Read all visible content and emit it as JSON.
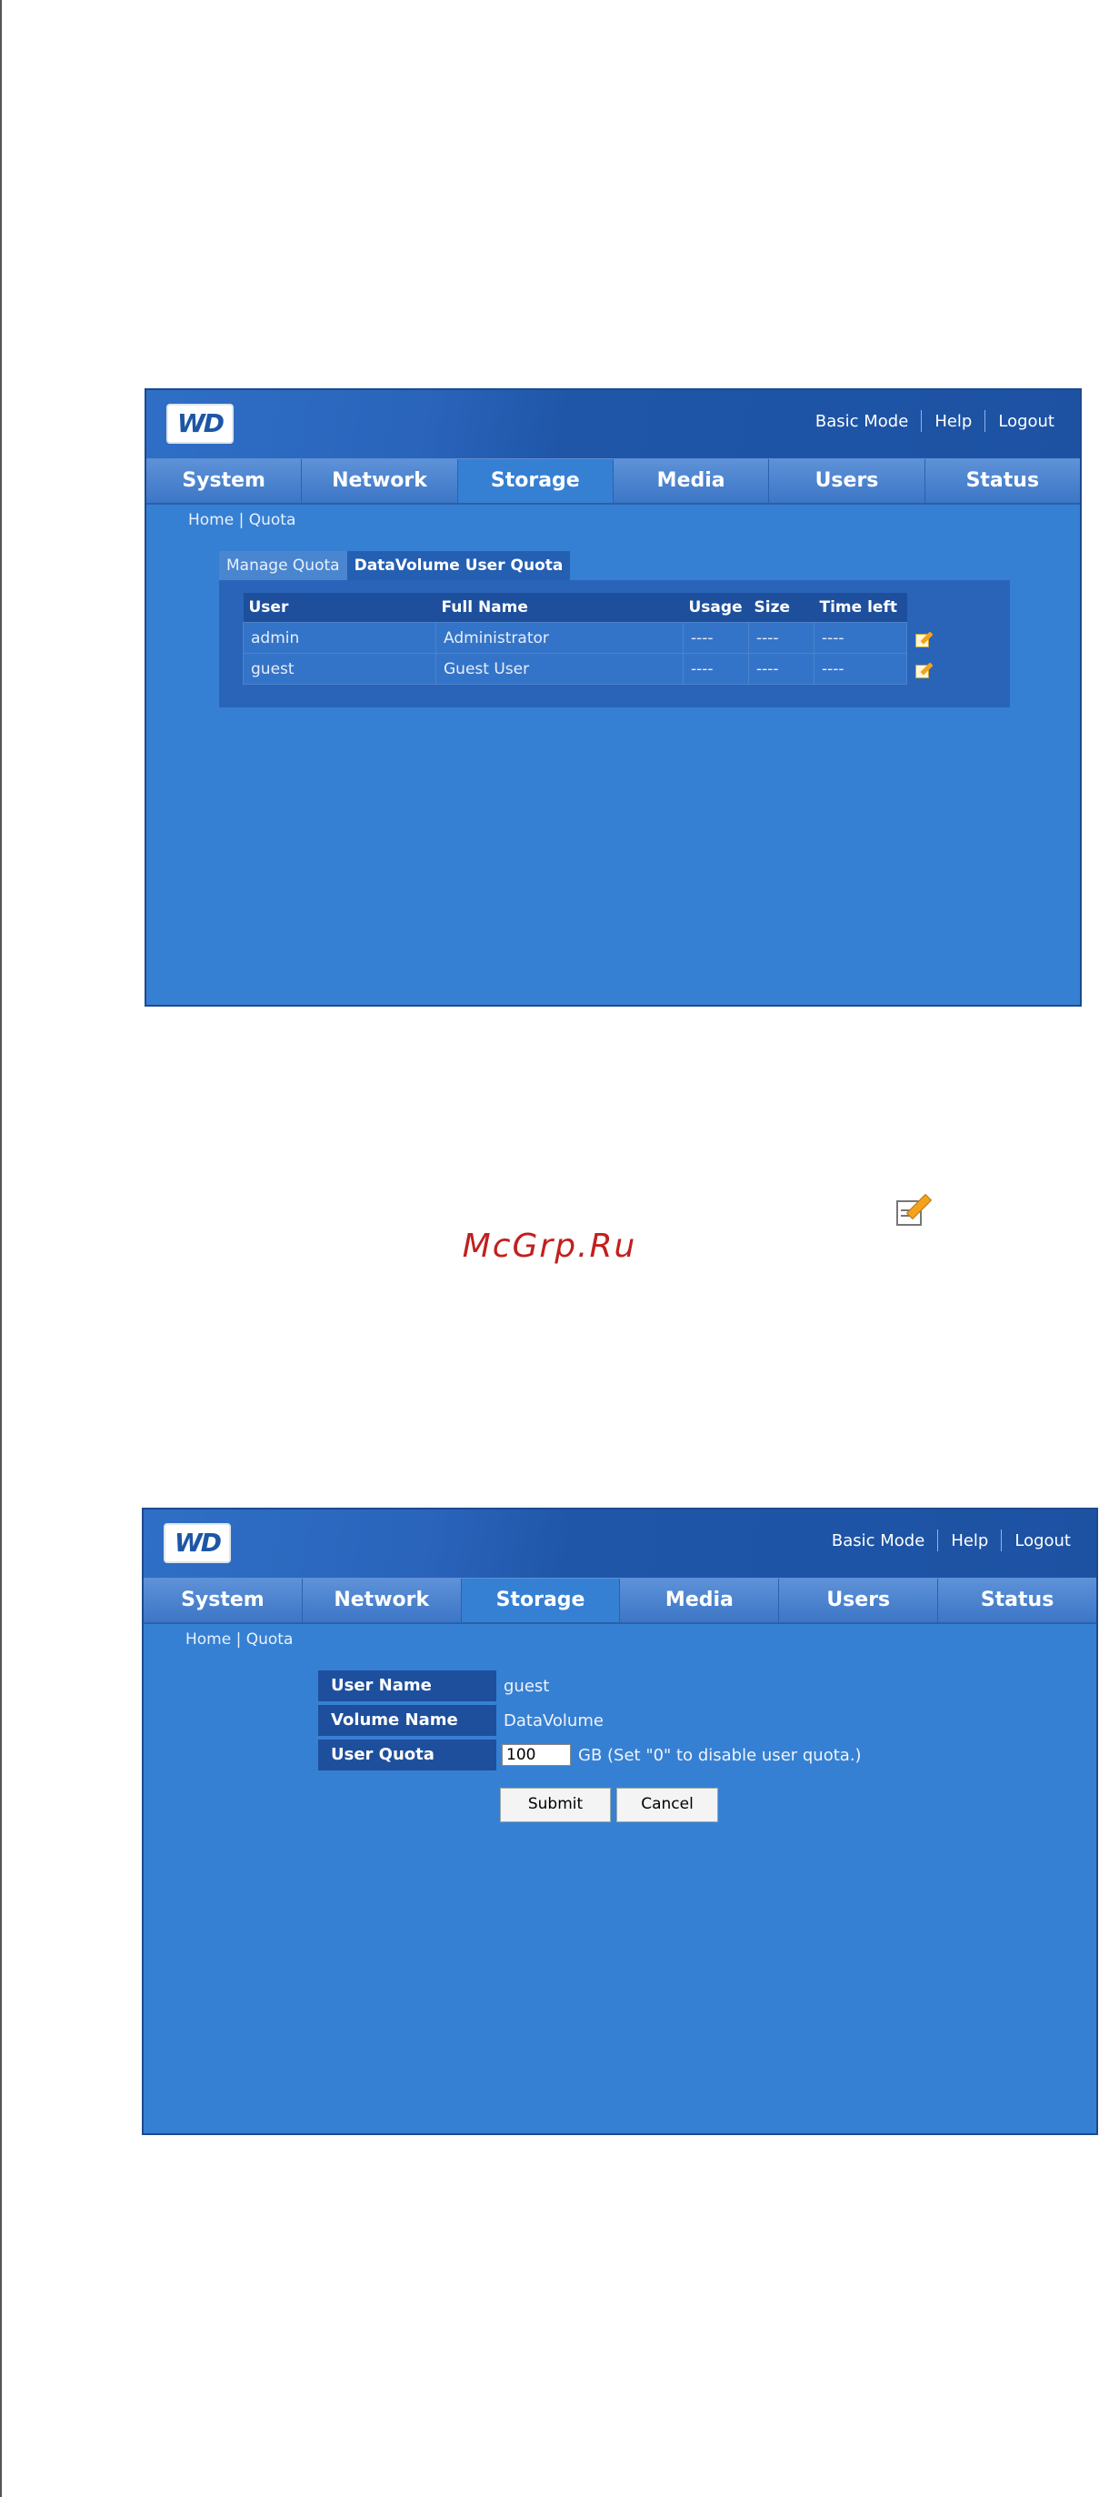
{
  "screen1": {
    "logo": "WD",
    "top_links": [
      "Basic Mode",
      "Help",
      "Logout"
    ],
    "tabs": [
      "System",
      "Network",
      "Storage",
      "Media",
      "Users",
      "Status"
    ],
    "active_tab": "Storage",
    "breadcrumb": "Home | Quota",
    "subtabs": [
      "Manage Quota",
      "DataVolume User Quota"
    ],
    "table": {
      "headers": [
        "User",
        "Full Name",
        "Usage",
        "Size",
        "Time left"
      ],
      "rows": [
        [
          "admin",
          "Administrator",
          "----",
          "----",
          "----"
        ],
        [
          "guest",
          "Guest User",
          "----",
          "----",
          "----"
        ]
      ]
    }
  },
  "watermark": "McGrp.Ru",
  "screen2": {
    "logo": "WD",
    "top_links": [
      "Basic Mode",
      "Help",
      "Logout"
    ],
    "tabs": [
      "System",
      "Network",
      "Storage",
      "Media",
      "Users",
      "Status"
    ],
    "active_tab": "Storage",
    "breadcrumb": "Home | Quota",
    "form": {
      "user_name_label": "User Name",
      "user_name_value": "guest",
      "volume_name_label": "Volume Name",
      "volume_name_value": "DataVolume",
      "user_quota_label": "User Quota",
      "user_quota_value": "100",
      "quota_hint": "GB (Set \"0\" to disable user quota.)",
      "submit": "Submit",
      "cancel": "Cancel"
    }
  }
}
